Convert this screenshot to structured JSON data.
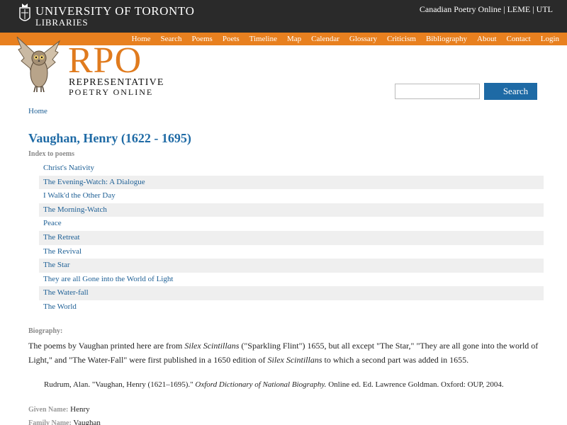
{
  "header": {
    "university_line1": "UNIVERSITY OF TORONTO",
    "university_line2": "LIBRARIES",
    "top_links": [
      "Canadian Poetry Online",
      "LEME",
      "UTL"
    ],
    "top_sep": "|"
  },
  "nav": {
    "items": [
      "Home",
      "Search",
      "Poems",
      "Poets",
      "Timeline",
      "Map",
      "Calendar",
      "Glossary",
      "Criticism",
      "Bibliography",
      "About",
      "Contact",
      "Login"
    ]
  },
  "logo": {
    "big": "RPO",
    "sub1": "REPRESENTATIVE",
    "sub2": "POETRY ONLINE"
  },
  "search": {
    "value": "",
    "placeholder": "",
    "button_label": "Search"
  },
  "breadcrumb": "Home",
  "poet": {
    "title": "Vaughan, Henry (1622 - 1695)",
    "index_label": "Index to poems",
    "poems": [
      "Christ's Nativity",
      "The Evening-Watch: A Dialogue",
      "I Walk'd the Other Day",
      "The Morning-Watch",
      "Peace",
      "The Retreat",
      "The Revival",
      "The Star",
      "They are all Gone into the World of Light",
      "The Water-fall",
      "The World"
    ]
  },
  "biography": {
    "label": "Biography:",
    "part1": "The poems by Vaughan printed here are from ",
    "ital1": "Silex Scintillans",
    "part2": " (\"Sparkling Flint\") 1655, but all except \"The Star,\" \"They are all gone into the world of Light,\" and \"The Water-Fall\" were first published in a 1650 edition of ",
    "ital2": "Silex Scintillans",
    "part3": " to which a second part was added in 1655."
  },
  "reference": {
    "part1": "Rudrum, Alan. \"Vaughan, Henry (1621–1695).\" ",
    "ital": "Oxford Dictionary of National Biography.",
    "part2": " Online ed. Ed. Lawrence Goldman. Oxford: OUP, 2004."
  },
  "meta": {
    "given_label": "Given Name:",
    "given_value": "Henry",
    "family_label": "Family Name:",
    "family_value": "Vaughan"
  },
  "colors": {
    "accent_orange": "#e8801f",
    "link_blue": "#1e6aa5",
    "topbar": "#2a2a2a"
  }
}
